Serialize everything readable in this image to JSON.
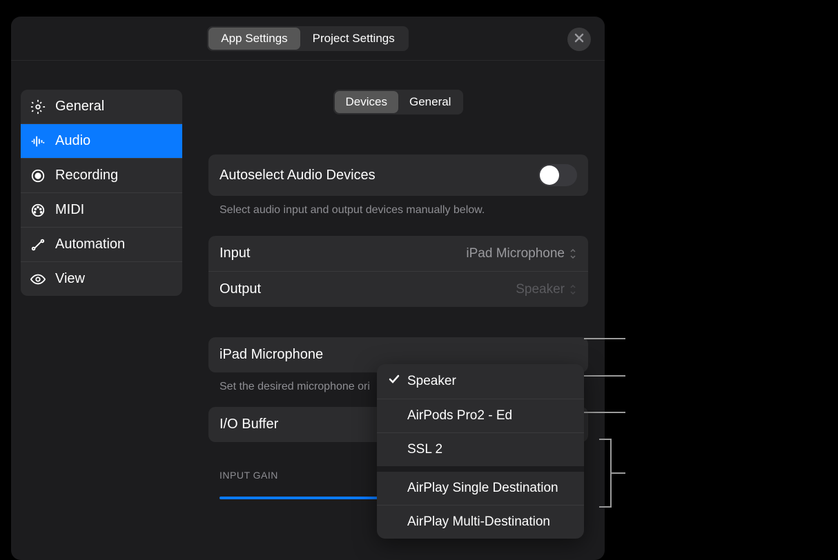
{
  "header": {
    "tabs": [
      "App Settings",
      "Project Settings"
    ],
    "active_tab": 0
  },
  "sidebar": {
    "items": [
      {
        "label": "General",
        "icon": "gear"
      },
      {
        "label": "Audio",
        "icon": "waveform"
      },
      {
        "label": "Recording",
        "icon": "record"
      },
      {
        "label": "MIDI",
        "icon": "midi"
      },
      {
        "label": "Automation",
        "icon": "automation"
      },
      {
        "label": "View",
        "icon": "eye"
      }
    ],
    "active_index": 1
  },
  "sub_tabs": {
    "items": [
      "Devices",
      "General"
    ],
    "active_index": 0
  },
  "autoselect": {
    "label": "Autoselect Audio Devices",
    "enabled": false,
    "description": "Select audio input and output devices manually below."
  },
  "io": {
    "input_label": "Input",
    "input_value": "iPad Microphone",
    "output_label": "Output",
    "output_value": "Speaker"
  },
  "mic_section": {
    "label": "iPad Microphone",
    "description": "Set the desired microphone ori"
  },
  "buffer": {
    "label": "I/O Buffer"
  },
  "input_gain": {
    "label": "INPUT GAIN",
    "value_percent": 61
  },
  "output_dropdown": {
    "groups": [
      {
        "items": [
          {
            "label": "Speaker",
            "checked": true
          },
          {
            "label": "AirPods Pro2 - Ed",
            "checked": false
          },
          {
            "label": "SSL 2",
            "checked": false
          }
        ]
      },
      {
        "items": [
          {
            "label": "AirPlay Single Destination",
            "checked": false
          },
          {
            "label": "AirPlay Multi-Destination",
            "checked": false
          }
        ]
      }
    ]
  }
}
